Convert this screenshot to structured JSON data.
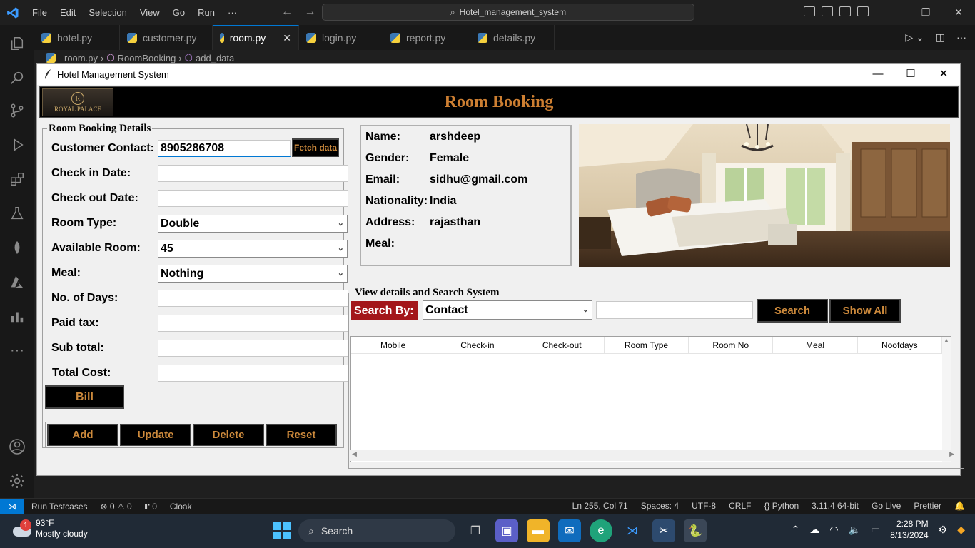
{
  "vscode": {
    "menu": [
      "File",
      "Edit",
      "Selection",
      "View",
      "Go",
      "Run",
      "···"
    ],
    "search": "Hotel_management_system",
    "tabs": [
      {
        "label": "hotel.py",
        "active": false
      },
      {
        "label": "customer.py",
        "active": false
      },
      {
        "label": "room.py",
        "active": true
      },
      {
        "label": "login.py",
        "active": false
      },
      {
        "label": "report.py",
        "active": false
      },
      {
        "label": "details.py",
        "active": false
      }
    ],
    "breadcrumb": [
      "room.py",
      "RoomBooking",
      "add_data"
    ],
    "status_left": [
      "Run Testcases",
      "⊗ 0 ⚠ 0",
      "⑈ 0",
      "Cloak"
    ],
    "status_right": [
      "Ln 255, Col 71",
      "Spaces: 4",
      "UTF-8",
      "CRLF",
      "{} Python",
      "3.11.4 64-bit",
      "Go Live",
      "Prettier"
    ]
  },
  "taskbar": {
    "temp": "93°F",
    "weather": "Mostly cloudy",
    "weather_badge": "1",
    "search": "Search",
    "time": "2:28 PM",
    "date": "8/13/2024"
  },
  "window": {
    "title": "Hotel Management System",
    "logo_text": "ROYAL PALACE",
    "logo_letter": "R",
    "header": "Room Booking"
  },
  "form": {
    "frame_title": "Room Booking Details",
    "labels": {
      "contact": "Customer Contact:",
      "checkin": "Check in Date:",
      "checkout": "Check out Date:",
      "roomtype": "Room Type:",
      "available": "Available Room:",
      "meal": "Meal:",
      "days": "No. of Days:",
      "tax": "Paid tax:",
      "subtotal": "Sub total:",
      "total": "Total Cost:"
    },
    "values": {
      "contact": "8905286708",
      "checkin": "",
      "checkout": "",
      "roomtype": "Double",
      "available": "45",
      "meal": "Nothing",
      "days": "",
      "tax": "",
      "subtotal": "",
      "total": ""
    },
    "fetch": "Fetch data",
    "bill": "Bill",
    "buttons": [
      "Add",
      "Update",
      "Delete",
      "Reset"
    ]
  },
  "customer_info": {
    "labels": [
      "Name:",
      "Gender:",
      "Email:",
      "Nationality:",
      "Address:",
      "Meal:"
    ],
    "values": [
      "arshdeep",
      "Female",
      "sidhu@gmail.com",
      "India",
      "rajasthan",
      ""
    ]
  },
  "search_system": {
    "frame_title": "View details and Search System",
    "search_by": "Search By:",
    "selected": "Contact",
    "query": "",
    "search_btn": "Search",
    "show_all_btn": "Show All",
    "columns": [
      "Mobile",
      "Check-in",
      "Check-out",
      "Room Type",
      "Room No",
      "Meal",
      "Noofdays"
    ]
  }
}
